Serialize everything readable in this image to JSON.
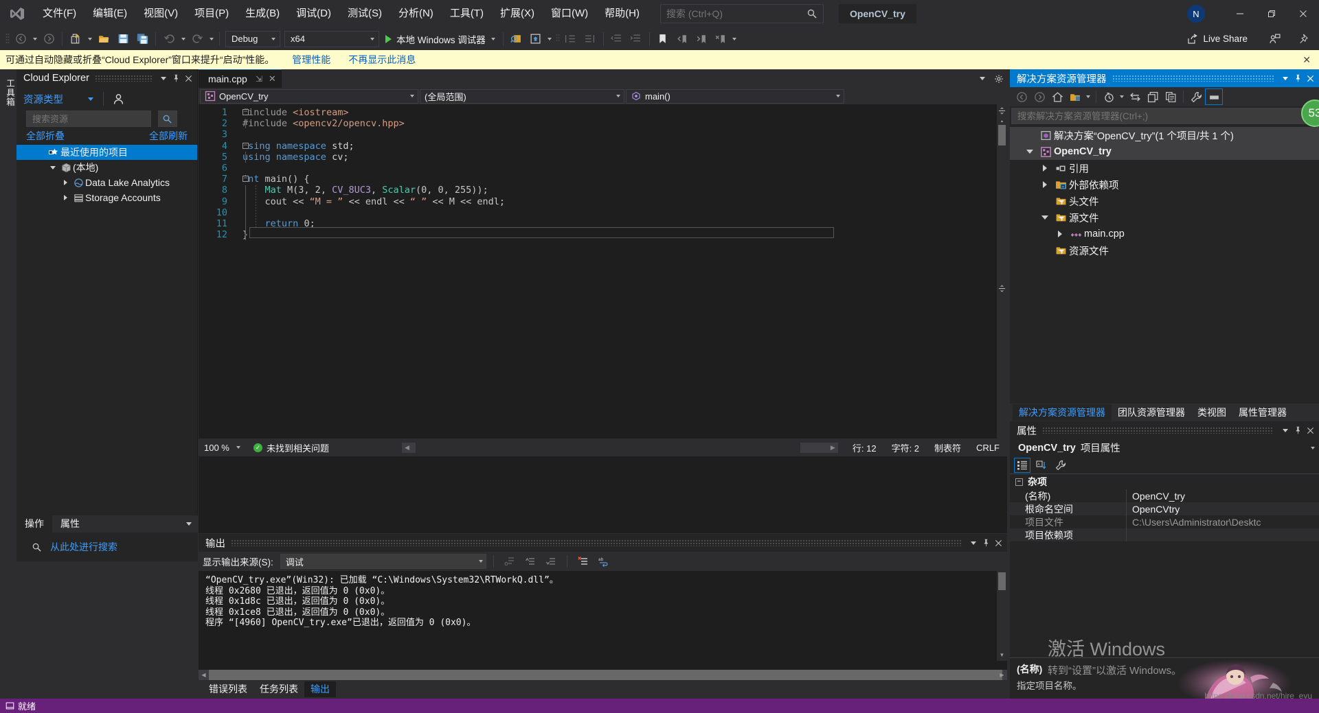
{
  "window": {
    "project_chip": "OpenCV_try",
    "account_initial": "N",
    "minimize": "—",
    "maximize": "❐",
    "close": "✕"
  },
  "menu": {
    "items": [
      "文件(F)",
      "编辑(E)",
      "视图(V)",
      "项目(P)",
      "生成(B)",
      "调试(D)",
      "测试(S)",
      "分析(N)",
      "工具(T)",
      "扩展(X)",
      "窗口(W)",
      "帮助(H)"
    ]
  },
  "quick_search": {
    "placeholder": "搜索 (Ctrl+Q)",
    "value": "",
    "icon": "search-icon"
  },
  "toolbar": {
    "configuration": "Debug",
    "platform": "x64",
    "run_label": "本地 Windows 调试器",
    "live_share": "Live Share"
  },
  "notification": {
    "message": "可通过自动隐藏或折叠“Cloud Explorer”窗口来提升“启动”性能。",
    "link_manage": "管理性能",
    "link_dismiss": "不再显示此消息",
    "close": "✕"
  },
  "left_vertical_tab": {
    "label": "工具箱"
  },
  "cloud_explorer": {
    "title": "Cloud Explorer",
    "resource_type_label": "资源类型",
    "search_placeholder": "搜索资源",
    "search_value": "",
    "clear_icon": "✕",
    "collapse_all": "全部折叠",
    "refresh_all": "全部刷新",
    "tree": [
      {
        "label": "最近使用的项目",
        "icon": "star-recent-icon",
        "indent": 1,
        "selected": true,
        "twisty": "none"
      },
      {
        "label": "(本地)",
        "icon": "cube-icon",
        "indent": 0,
        "selected": false,
        "twisty": "open"
      },
      {
        "label": "Data Lake Analytics",
        "icon": "datalake-icon",
        "indent": 1,
        "selected": false,
        "twisty": "closed"
      },
      {
        "label": "Storage Accounts",
        "icon": "storage-icon",
        "indent": 1,
        "selected": false,
        "twisty": "closed"
      }
    ]
  },
  "left_bottom": {
    "tabs": [
      "操作",
      "属性"
    ],
    "active_tab": "属性",
    "search_link": "从此处进行搜索"
  },
  "editor": {
    "tab_name": "main.cpp",
    "tab_pin": "⇲",
    "tab_close": "✕",
    "nav_project": "OpenCV_try",
    "nav_scope": "(全局范围)",
    "nav_member": "main()",
    "code_lines": [
      {
        "n": "1",
        "text": "#include <iostream>"
      },
      {
        "n": "2",
        "text": "#include <opencv2/opencv.hpp>"
      },
      {
        "n": "3",
        "text": ""
      },
      {
        "n": "4",
        "text": "using namespace std;"
      },
      {
        "n": "5",
        "text": "using namespace cv;"
      },
      {
        "n": "6",
        "text": ""
      },
      {
        "n": "7",
        "text": "int main() {"
      },
      {
        "n": "8",
        "text": "    Mat M(3, 2, CV_8UC3, Scalar(0, 0, 255));"
      },
      {
        "n": "9",
        "text": "    cout << “M = ” << endl << “ ” << M << endl;"
      },
      {
        "n": "10",
        "text": ""
      },
      {
        "n": "11",
        "text": "    return 0;"
      },
      {
        "n": "12",
        "text": "}"
      }
    ],
    "status": {
      "zoom": "100 %",
      "issues": "未找到相关问题",
      "line": "行: 12",
      "col": "字符: 2",
      "tabs": "制表符",
      "eol": "CRLF"
    }
  },
  "output": {
    "title": "输出",
    "source_label": "显示输出来源(S):",
    "source_value": "调试",
    "log_lines": [
      "“OpenCV_try.exe”(Win32): 已加载 “C:\\Windows\\System32\\RTWorkQ.dll”。",
      "线程 0x2680 已退出，返回值为 0 (0x0)。",
      "线程 0x1d8c 已退出，返回值为 0 (0x0)。",
      "线程 0x1ce8 已退出，返回值为 0 (0x0)。",
      "程序 “[4960] OpenCV_try.exe”已退出，返回值为 0 (0x0)。"
    ],
    "tabs": [
      "错误列表",
      "任务列表",
      "输出"
    ],
    "active_tab": "输出"
  },
  "solution_explorer": {
    "title": "解决方案资源管理器",
    "search_placeholder": "搜索解决方案资源管理器(Ctrl+;)",
    "search_value": "",
    "notification_count": "53",
    "tree": [
      {
        "label": "解决方案“OpenCV_try”(1 个项目/共 1 个)",
        "icon": "solution-icon",
        "indent": 0,
        "twisty": "none",
        "bold": false
      },
      {
        "label": "OpenCV_try",
        "icon": "cpp-project-icon",
        "indent": 0,
        "twisty": "open",
        "bold": true
      },
      {
        "label": "引用",
        "icon": "references-icon",
        "indent": 1,
        "twisty": "closed",
        "bold": false
      },
      {
        "label": "外部依赖项",
        "icon": "ext-deps-icon",
        "indent": 1,
        "twisty": "closed",
        "bold": false
      },
      {
        "label": "头文件",
        "icon": "folder-filter-icon",
        "indent": 1,
        "twisty": "none",
        "bold": false
      },
      {
        "label": "源文件",
        "icon": "folder-filter-icon",
        "indent": 1,
        "twisty": "open",
        "bold": false
      },
      {
        "label": "main.cpp",
        "icon": "cpp-file-icon",
        "indent": 2,
        "twisty": "closed",
        "bold": false
      },
      {
        "label": "资源文件",
        "icon": "folder-filter-icon",
        "indent": 1,
        "twisty": "none",
        "bold": false
      }
    ]
  },
  "right_doc_tabs": {
    "tabs": [
      "解决方案资源管理器",
      "团队资源管理器",
      "类视图",
      "属性管理器"
    ],
    "active_tab": "解决方案资源管理器"
  },
  "properties": {
    "title": "属性",
    "object_name": "OpenCV_try",
    "object_kind": "项目属性",
    "group": "杂项",
    "rows": [
      {
        "key": "(名称)",
        "value": "OpenCV_try",
        "dim": false
      },
      {
        "key": "根命名空间",
        "value": "OpenCVtry",
        "dim": false
      },
      {
        "key": "项目文件",
        "value": "C:\\Users\\Administrator\\Desktc",
        "dim": true
      },
      {
        "key": "项目依赖项",
        "value": "",
        "dim": false
      }
    ],
    "desc_title": "(名称)",
    "desc_body": "指定项目名称。"
  },
  "watermark": {
    "line1": "激活 Windows",
    "line2": "转到“设置”以激活 Windows。",
    "csdn": "https://blog.csdn.net/hire_eyu"
  },
  "statusbar": {
    "text": "就绪",
    "icon": "ready-icon"
  },
  "colors": {
    "accent_blue": "#007acc",
    "status_purple": "#68217a",
    "notification_yellow": "#fffccc",
    "chrome_dark": "#2d2d30",
    "panel_dark": "#252526",
    "editor_dark": "#1e1e1e",
    "link_blue": "#3b9dff"
  }
}
